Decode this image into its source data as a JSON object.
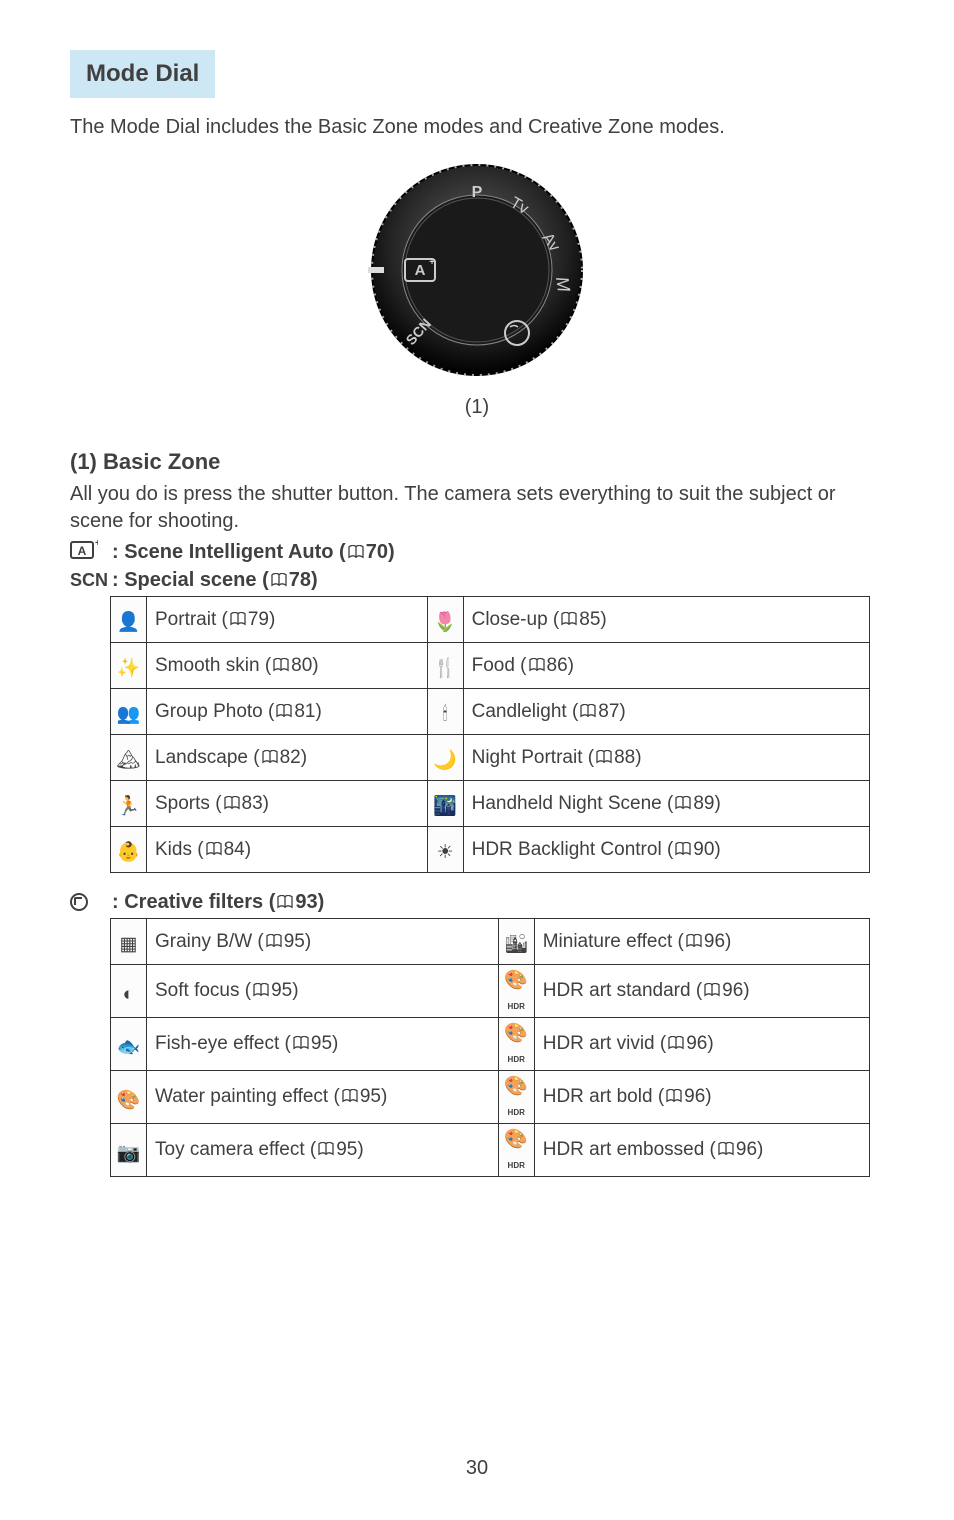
{
  "header": "Mode Dial",
  "intro": "The Mode Dial includes the Basic Zone modes and Creative Zone modes.",
  "dial_caption": "(1)",
  "basic_zone": {
    "title": "(1) Basic Zone",
    "desc": "All you do is press the shutter button. The camera sets everything to suit the subject or scene for shooting.",
    "scene_intelligent": {
      "label": ": Scene Intelligent Auto (",
      "page": "70",
      "close": ")"
    },
    "special_scene": {
      "prefix": "SCN",
      "label": ": Special scene (",
      "page": "78",
      "close": ")"
    }
  },
  "scn_table": [
    {
      "iconL": "👤",
      "nameL": "Portrait",
      "pageL": "79",
      "iconR": "🌷",
      "nameR": "Close-up",
      "pageR": "85"
    },
    {
      "iconL": "✨",
      "nameL": "Smooth skin",
      "pageL": "80",
      "iconR": "🍴",
      "nameR": "Food",
      "pageR": "86"
    },
    {
      "iconL": "👥",
      "nameL": "Group Photo",
      "pageL": "81",
      "iconR": "🕯",
      "nameR": "Candlelight",
      "pageR": "87"
    },
    {
      "iconL": "🏔",
      "nameL": "Landscape",
      "pageL": "82",
      "iconR": "🌙",
      "nameR": "Night Portrait",
      "pageR": "88"
    },
    {
      "iconL": "🏃",
      "nameL": "Sports",
      "pageL": "83",
      "iconR": "🌃",
      "nameR": "Handheld Night Scene",
      "pageR": "89"
    },
    {
      "iconL": "👶",
      "nameL": "Kids",
      "pageL": "84",
      "iconR": "☀",
      "nameR": "HDR Backlight Control",
      "pageR": "90"
    }
  ],
  "creative_filters": {
    "label": ": Creative filters (",
    "page": "93",
    "close": ")"
  },
  "filters_table": [
    {
      "iconL": "▦",
      "nameL": "Grainy B/W",
      "pageL": "95",
      "iconR": "🏙",
      "nameR": "Miniature effect",
      "pageR": "96"
    },
    {
      "iconL": "◐",
      "nameL": "Soft focus",
      "pageL": "95",
      "iconR": "HDR",
      "iconRType": "hdr",
      "nameR": "HDR art standard",
      "pageR": "96"
    },
    {
      "iconL": "🐟",
      "nameL": "Fish-eye effect",
      "pageL": "95",
      "iconR": "HDR",
      "iconRType": "hdr",
      "nameR": "HDR art vivid",
      "pageR": "96"
    },
    {
      "iconL": "🎨",
      "nameL": "Water painting effect",
      "pageL": "95",
      "iconR": "HDR",
      "iconRType": "hdr",
      "nameR": "HDR art bold",
      "pageR": "96"
    },
    {
      "iconL": "📷",
      "nameL": "Toy camera effect",
      "pageL": "95",
      "iconR": "HDR",
      "iconRType": "hdr",
      "nameR": "HDR art embossed",
      "pageR": "96"
    }
  ],
  "page_number": "30"
}
